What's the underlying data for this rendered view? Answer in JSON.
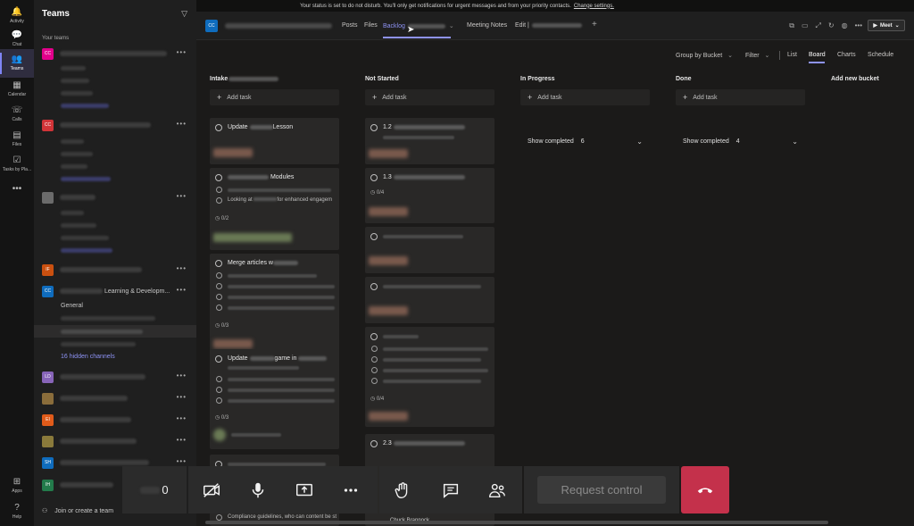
{
  "banner": {
    "message": "Your status is set to do not disturb. You'll only get notifications for urgent messages and from your priority contacts.",
    "link": "Change settings."
  },
  "rail": [
    {
      "label": "Activity",
      "icon": "bell-icon",
      "glyph": "🔔"
    },
    {
      "label": "Chat",
      "icon": "chat-icon",
      "glyph": "💬"
    },
    {
      "label": "Teams",
      "icon": "teams-icon",
      "glyph": "👥"
    },
    {
      "label": "Calendar",
      "icon": "calendar-icon",
      "glyph": "▦"
    },
    {
      "label": "Calls",
      "icon": "phone-icon",
      "glyph": "☏"
    },
    {
      "label": "Files",
      "icon": "file-icon",
      "glyph": "▤"
    },
    {
      "label": "Tasks by Pla...",
      "icon": "tasks-icon",
      "glyph": "☑"
    },
    {
      "label": "",
      "icon": "more-icon",
      "glyph": "•••"
    },
    {
      "label": "Apps",
      "icon": "apps-icon",
      "glyph": "⊞"
    },
    {
      "label": "Help",
      "icon": "help-icon",
      "glyph": "?"
    }
  ],
  "teams_panel": {
    "title": "Teams",
    "section": "Your teams",
    "teams": [
      {
        "initials": "CC",
        "color": "#e3008c",
        "name": ""
      },
      {
        "initials": "CC",
        "color": "#d13438",
        "name": ""
      },
      {
        "initials": "",
        "color": "#6b6b6b",
        "name": ""
      },
      {
        "initials": "IF",
        "color": "#ca5010",
        "name": ""
      },
      {
        "initials": "CC",
        "color": "#0f6cbd",
        "name": "Learning & Developm..."
      },
      {
        "initials": "LD",
        "color": "#8764b8",
        "name": ""
      },
      {
        "initials": "",
        "color": "#8a6d3b",
        "name": ""
      },
      {
        "initials": "EI",
        "color": "#e05b1a",
        "name": ""
      },
      {
        "initials": "",
        "color": "#8a7a3b",
        "name": ""
      },
      {
        "initials": "SH",
        "color": "#0f6cbd",
        "name": ""
      },
      {
        "initials": "IH",
        "color": "#237b4b",
        "name": ""
      }
    ],
    "channel_general": "General",
    "hidden_channels": "16 hidden channels",
    "join_label": "Join or create a team"
  },
  "tabs": {
    "team_badge": "CC",
    "posts": "Posts",
    "files": "Files",
    "backlog": "Backlog",
    "meeting_notes": "Meeting Notes",
    "edit": "Edit |",
    "add": "+",
    "meet": "Meet"
  },
  "subbar": {
    "group_by": "Group by Bucket",
    "filter": "Filter",
    "list": "List",
    "board": "Board",
    "charts": "Charts",
    "schedule": "Schedule"
  },
  "board": {
    "add_task_label": "Add task",
    "add_bucket": "Add new bucket",
    "buckets": [
      {
        "title": "Intake"
      },
      {
        "title": "Not Started"
      },
      {
        "title": "In Progress",
        "show_completed": "Show completed",
        "count": "6"
      },
      {
        "title": "Done",
        "show_completed": "Show completed",
        "count": "4"
      }
    ],
    "intake_cards": {
      "c1_title": "Update",
      "c1_title_end": "Lesson",
      "c2_title_end": "Modules",
      "c2_line": "Looking at",
      "c2_line_end": "for enhanced engagem",
      "c2_progress": "0/2",
      "c3_title": "Merge articles w",
      "c3_progress": "0/3",
      "c4_title": "Update",
      "c4_title_mid": "game in",
      "c4_progress": "0/3",
      "c5_line": "Compliance guidelines, who can content be st"
    },
    "notstarted_cards": {
      "c1_title": "1.2",
      "c2_title": "1.3",
      "c2_progress": "0/4",
      "c5_progress": "0/4",
      "c6_title": "2.3",
      "c6_person": "Chuck Brannock"
    }
  },
  "call": {
    "timer": "0",
    "request_control": "Request control"
  }
}
